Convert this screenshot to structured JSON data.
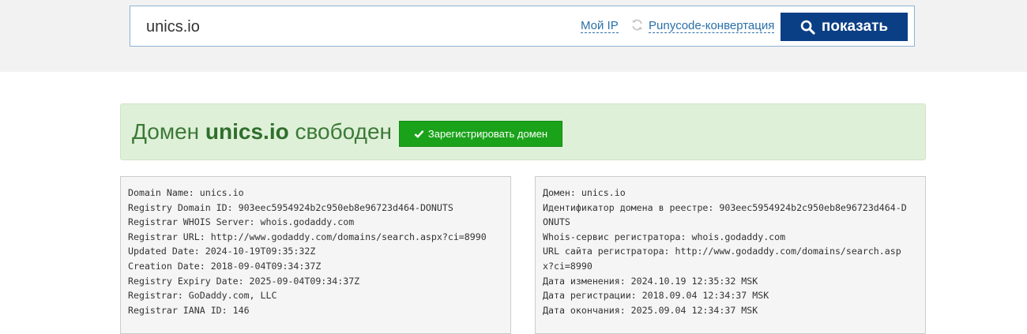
{
  "search": {
    "value": "unics.io",
    "my_ip_label": "Мой IP",
    "refresh_icon": "refresh-icon",
    "punycode_label": "Punycode-конвертация",
    "show_label": "показать",
    "show_icon": "search-icon"
  },
  "status": {
    "prefix": "Домен",
    "domain": "unics.io",
    "suffix": "свободен",
    "register_label": "Зарегистрировать домен",
    "register_icon": "check-icon"
  },
  "whois_original": [
    "Domain Name: unics.io",
    "Registry Domain ID: 903eec5954924b2c950eb8e96723d464-DONUTS",
    "Registrar WHOIS Server: whois.godaddy.com",
    "Registrar URL: http://www.godaddy.com/domains/search.aspx?ci=8990",
    "Updated Date: 2024-10-19T09:35:32Z",
    "Creation Date: 2018-09-04T09:34:37Z",
    "Registry Expiry Date: 2025-09-04T09:34:37Z",
    "Registrar: GoDaddy.com, LLC",
    "Registrar IANA ID: 146"
  ],
  "whois_translated": [
    "Домен: unics.io",
    "Идентификатор домена в реестре: 903eec5954924b2c950eb8e96723d464-D",
    "ONUTS",
    "Whois-сервис регистратора: whois.godaddy.com",
    "URL сайта регистратора: http://www.godaddy.com/domains/search.asp",
    "x?ci=8990",
    "Дата изменения: 2024.10.19 12:35:32 MSK",
    "Дата регистрации: 2018.09.04 12:34:37 MSK",
    "Дата окончания: 2025.09.04 12:34:37 MSK"
  ],
  "colors": {
    "accent": "#0b3f85",
    "link": "#2a6fa8",
    "success_bg": "#dff0d8",
    "success_text": "#3c7a38",
    "register_button": "#1aa31a"
  }
}
